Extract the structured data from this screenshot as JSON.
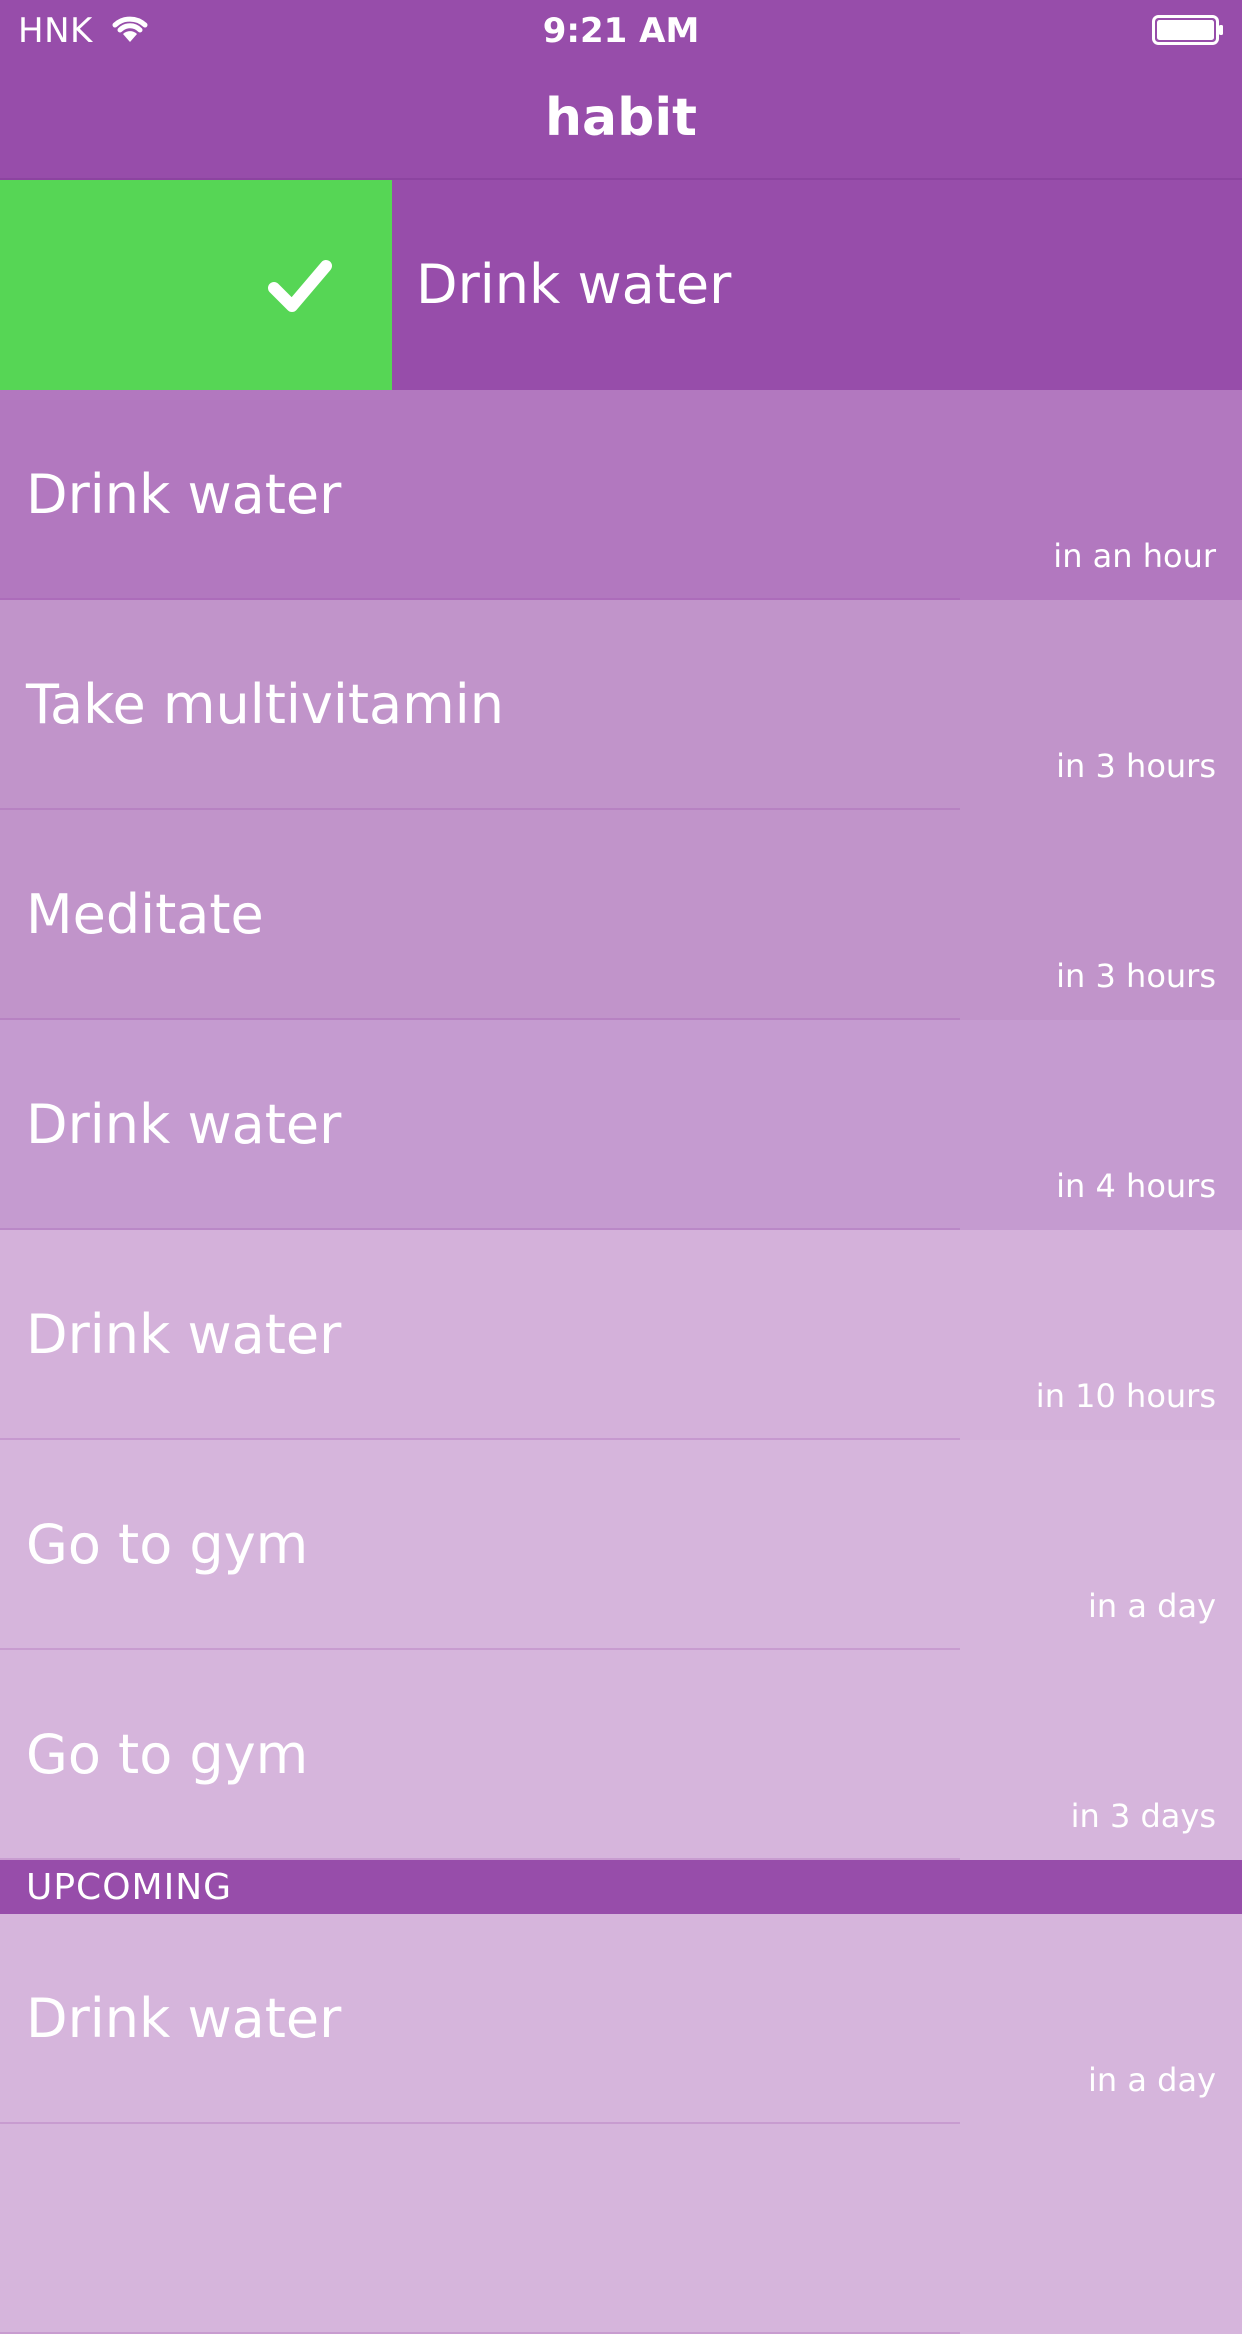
{
  "status_bar": {
    "carrier": "HNK",
    "time": "9:21 AM"
  },
  "nav": {
    "title": "habit"
  },
  "swiped_row": {
    "label": "Drink water"
  },
  "rows": [
    {
      "name": "Drink water",
      "time": "in an hour",
      "bg": "#b278bf"
    },
    {
      "name": "Take multivitamin",
      "time": "in 3 hours",
      "bg": "#c194ca"
    },
    {
      "name": "Meditate",
      "time": "in 3 hours",
      "bg": "#c194ca"
    },
    {
      "name": "Drink water",
      "time": "in 4 hours",
      "bg": "#c59bd0"
    },
    {
      "name": "Drink water",
      "time": "in 10 hours",
      "bg": "#d4b1da"
    },
    {
      "name": "Go to gym",
      "time": "in a day",
      "bg": "#d6b5dc"
    },
    {
      "name": "Go to gym",
      "time": "in 3 days",
      "bg": "#d6b5dc"
    }
  ],
  "upcoming": {
    "header": "UPCOMING",
    "rows": [
      {
        "name": "Drink water",
        "time": "in a day",
        "bg": "#d6b5dc"
      },
      {
        "name": "",
        "time": "",
        "bg": "#d6b5dc"
      }
    ]
  },
  "colors": {
    "primary": "#974daa",
    "complete_green": "#56d655"
  }
}
